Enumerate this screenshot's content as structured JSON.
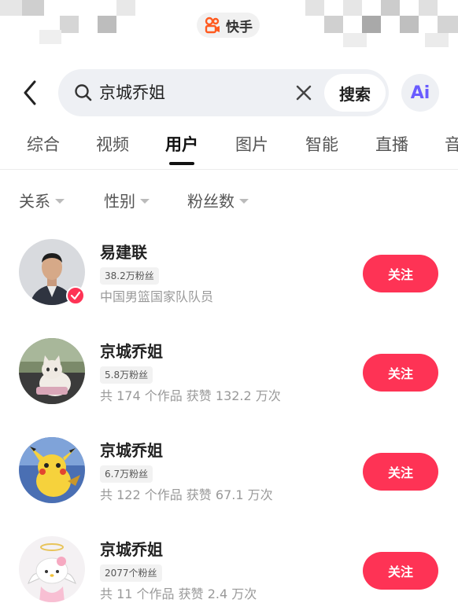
{
  "brand": {
    "name": "快手"
  },
  "search": {
    "query": "京城乔姐",
    "button_label": "搜索"
  },
  "ai": {
    "label": "Ai"
  },
  "tabs": [
    {
      "label": "综合"
    },
    {
      "label": "视频"
    },
    {
      "label": "用户"
    },
    {
      "label": "图片"
    },
    {
      "label": "智能"
    },
    {
      "label": "直播"
    },
    {
      "label": "音"
    }
  ],
  "active_tab": "用户",
  "filters": [
    {
      "label": "关系"
    },
    {
      "label": "性别"
    },
    {
      "label": "粉丝数"
    }
  ],
  "users": [
    {
      "name": "易建联",
      "fans": "38.2万粉丝",
      "desc": "中国男篮国家队队员",
      "verified": true,
      "follow_label": "关注"
    },
    {
      "name": "京城乔姐",
      "fans": "5.8万粉丝",
      "desc": "共 174 个作品  获赞 132.2 万次",
      "verified": false,
      "follow_label": "关注"
    },
    {
      "name": "京城乔姐",
      "fans": "6.7万粉丝",
      "desc": "共 122 个作品  获赞 67.1 万次",
      "verified": false,
      "follow_label": "关注"
    },
    {
      "name": "京城乔姐",
      "fans": "2077个粉丝",
      "desc": "共 11 个作品  获赞 2.4 万次",
      "verified": false,
      "follow_label": "关注"
    }
  ],
  "colors": {
    "accent": "#fe3355",
    "search_bg": "#eef0f4",
    "ai_purple": "#6a5cff"
  }
}
